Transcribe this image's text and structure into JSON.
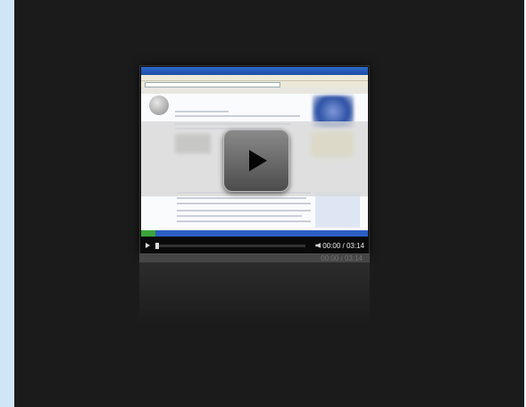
{
  "player": {
    "time_display": "00:00 / 03:14",
    "progress_fraction": 0.0,
    "play_icon": "play-icon",
    "volume_icon": "volume-icon"
  },
  "captured_page": {
    "window_title": "",
    "page_title": "",
    "logo_icon": "wiki-globe-logo-icon"
  },
  "colors": {
    "stage": "#1b1b1b",
    "frame": "#d9eaf7",
    "titlebar": "#2f68c9",
    "taskbar": "#2b5fc4"
  }
}
